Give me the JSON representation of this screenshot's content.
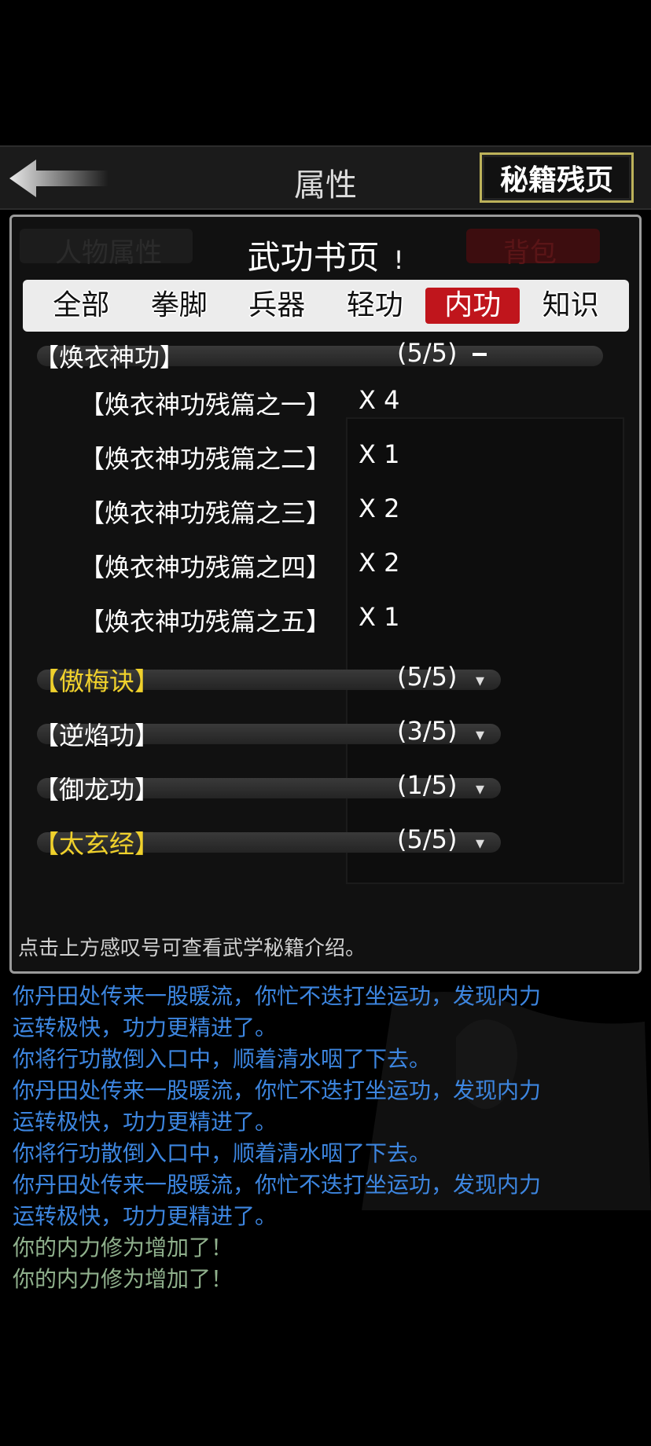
{
  "header": {
    "title": "属性",
    "scroll_button": "秘籍残页"
  },
  "panel": {
    "ghost_tab_left": "人物属性",
    "ghost_tab_right": "背包",
    "title": "武功书页",
    "info_mark": "!",
    "tabs": [
      {
        "label": "全部",
        "active": false
      },
      {
        "label": "拳脚",
        "active": false
      },
      {
        "label": "兵器",
        "active": false
      },
      {
        "label": "轻功",
        "active": false
      },
      {
        "label": "内功",
        "active": true
      },
      {
        "label": "知识",
        "active": false
      }
    ],
    "groups": [
      {
        "name": "【焕衣神功】",
        "count": "(5/5)",
        "expanded": true,
        "gold": false
      },
      {
        "name": "【傲梅诀】",
        "count": "(5/5)",
        "expanded": false,
        "gold": true
      },
      {
        "name": "【逆焰功】",
        "count": "(3/5)",
        "expanded": false,
        "gold": false
      },
      {
        "name": "【御龙功】",
        "count": "(1/5)",
        "expanded": false,
        "gold": false
      },
      {
        "name": "【太玄经】",
        "count": "(5/5)",
        "expanded": false,
        "gold": true
      }
    ],
    "fragments": [
      {
        "name": "【焕衣神功残篇之一】",
        "qty": "X 4"
      },
      {
        "name": "【焕衣神功残篇之二】",
        "qty": "X 1"
      },
      {
        "name": "【焕衣神功残篇之三】",
        "qty": "X 2"
      },
      {
        "name": "【焕衣神功残篇之四】",
        "qty": "X 2"
      },
      {
        "name": "【焕衣神功残篇之五】",
        "qty": "X 1"
      }
    ],
    "hint": "点击上方感叹号可查看武学秘籍介绍。"
  },
  "log": [
    {
      "text": "你丹田处传来一股暖流，你忙不迭打坐运功，发现内力",
      "color": "blue"
    },
    {
      "text": "运转极快，功力更精进了。",
      "color": "blue"
    },
    {
      "text": "你将行功散倒入口中，顺着清水咽了下去。",
      "color": "blue"
    },
    {
      "text": "你丹田处传来一股暖流，你忙不迭打坐运功，发现内力",
      "color": "blue"
    },
    {
      "text": "运转极快，功力更精进了。",
      "color": "blue"
    },
    {
      "text": "你将行功散倒入口中，顺着清水咽了下去。",
      "color": "blue"
    },
    {
      "text": "你丹田处传来一股暖流，你忙不迭打坐运功，发现内力",
      "color": "blue"
    },
    {
      "text": "运转极快，功力更精进了。",
      "color": "blue"
    },
    {
      "text": "你的内力修为增加了！",
      "color": "green"
    },
    {
      "text": "你的内力修为增加了！",
      "color": "green"
    }
  ],
  "colors": {
    "accent_red": "#c0151c",
    "gold": "#f0d12c",
    "log_blue": "#3d86e0",
    "log_green": "#8fb08c"
  }
}
